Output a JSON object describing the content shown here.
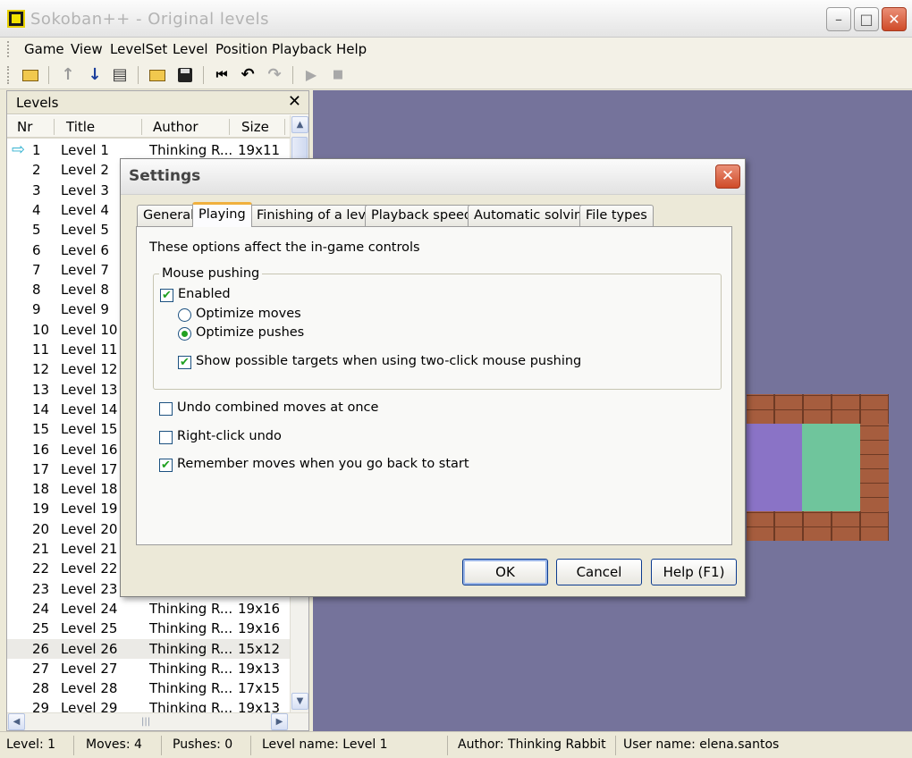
{
  "window": {
    "title": "Sokoban++ - Original levels",
    "minimize_glyph": "–",
    "maximize_glyph": "□",
    "close_glyph": "✕"
  },
  "menu": {
    "items": [
      "Game",
      "View",
      "LevelSet",
      "Level",
      "Position",
      "Playback",
      "Help"
    ]
  },
  "toolbar": {
    "icons": [
      "open-folder-icon",
      "arrow-up-icon",
      "arrow-down-icon",
      "level-list-icon",
      "open-file-icon",
      "save-icon",
      "rewind-icon",
      "undo-icon",
      "redo-icon",
      "play-icon",
      "stop-icon"
    ],
    "glyphs": {
      "up": "↑",
      "down": "↓",
      "list": "▤",
      "rewind": "⏮",
      "undo": "↶",
      "redo": "↷",
      "play": "▶",
      "stop": "■"
    }
  },
  "levels_panel": {
    "title": "Levels",
    "close_glyph": "✕",
    "columns": [
      "Nr",
      "Title",
      "Author",
      "Size"
    ],
    "current_marker": "⇨",
    "rows": [
      {
        "nr": "1",
        "title": "Level 1",
        "author": "Thinking R...",
        "size": "19x11"
      },
      {
        "nr": "2",
        "title": "Level 2",
        "author": "",
        "size": ""
      },
      {
        "nr": "3",
        "title": "Level 3",
        "author": "",
        "size": ""
      },
      {
        "nr": "4",
        "title": "Level 4",
        "author": "",
        "size": ""
      },
      {
        "nr": "5",
        "title": "Level 5",
        "author": "",
        "size": ""
      },
      {
        "nr": "6",
        "title": "Level 6",
        "author": "",
        "size": ""
      },
      {
        "nr": "7",
        "title": "Level 7",
        "author": "",
        "size": ""
      },
      {
        "nr": "8",
        "title": "Level 8",
        "author": "",
        "size": ""
      },
      {
        "nr": "9",
        "title": "Level 9",
        "author": "",
        "size": ""
      },
      {
        "nr": "10",
        "title": "Level 10",
        "author": "",
        "size": ""
      },
      {
        "nr": "11",
        "title": "Level 11",
        "author": "",
        "size": ""
      },
      {
        "nr": "12",
        "title": "Level 12",
        "author": "",
        "size": ""
      },
      {
        "nr": "13",
        "title": "Level 13",
        "author": "",
        "size": ""
      },
      {
        "nr": "14",
        "title": "Level 14",
        "author": "",
        "size": ""
      },
      {
        "nr": "15",
        "title": "Level 15",
        "author": "",
        "size": ""
      },
      {
        "nr": "16",
        "title": "Level 16",
        "author": "",
        "size": ""
      },
      {
        "nr": "17",
        "title": "Level 17",
        "author": "",
        "size": ""
      },
      {
        "nr": "18",
        "title": "Level 18",
        "author": "",
        "size": ""
      },
      {
        "nr": "19",
        "title": "Level 19",
        "author": "",
        "size": ""
      },
      {
        "nr": "20",
        "title": "Level 20",
        "author": "",
        "size": ""
      },
      {
        "nr": "21",
        "title": "Level 21",
        "author": "",
        "size": ""
      },
      {
        "nr": "22",
        "title": "Level 22",
        "author": "",
        "size": ""
      },
      {
        "nr": "23",
        "title": "Level 23",
        "author": "",
        "size": ""
      },
      {
        "nr": "24",
        "title": "Level 24",
        "author": "Thinking R...",
        "size": "19x16"
      },
      {
        "nr": "25",
        "title": "Level 25",
        "author": "Thinking R...",
        "size": "19x16"
      },
      {
        "nr": "26",
        "title": "Level 26",
        "author": "Thinking R...",
        "size": "15x12"
      },
      {
        "nr": "27",
        "title": "Level 27",
        "author": "Thinking R...",
        "size": "19x13"
      },
      {
        "nr": "28",
        "title": "Level 28",
        "author": "Thinking R...",
        "size": "17x15"
      },
      {
        "nr": "29",
        "title": "Level 29",
        "author": "Thinking R...",
        "size": "19x13"
      }
    ],
    "selected_row": "26",
    "scroll_up_glyph": "▲",
    "scroll_down_glyph": "▼",
    "scroll_left_glyph": "◀",
    "scroll_right_glyph": "▶",
    "hscroll_grip": "|||"
  },
  "settings_dialog": {
    "title": "Settings",
    "close_glyph": "✕",
    "tabs": [
      "General",
      "Playing",
      "Finishing of a level",
      "Playback speed",
      "Automatic solving",
      "File types"
    ],
    "active_tab": "Playing",
    "intro": "These options affect the in-game controls",
    "mouse_pushing": {
      "legend": "Mouse pushing",
      "enabled_label": "Enabled",
      "enabled": true,
      "optimize_moves_label": "Optimize moves",
      "optimize_moves": false,
      "optimize_pushes_label": "Optimize pushes",
      "optimize_pushes": true,
      "show_targets_label": "Show possible targets when using two-click mouse pushing",
      "show_targets": true
    },
    "undo_combined_label": "Undo combined moves at once",
    "undo_combined": false,
    "right_click_undo_label": "Right-click undo",
    "right_click_undo": false,
    "remember_moves_label": "Remember moves when you go back to start",
    "remember_moves": true,
    "check_glyph": "✔",
    "buttons": {
      "ok": "OK",
      "cancel": "Cancel",
      "help": "Help (F1)"
    }
  },
  "statusbar": {
    "level": "Level: 1",
    "moves": "Moves: 4",
    "pushes": "Pushes: 0",
    "level_name": "Level name: Level 1",
    "author": "Author: Thinking Rabbit",
    "user": "User name: elena.santos"
  },
  "colors": {
    "game_background": "#75739b",
    "wall_brick": "#a65d3e",
    "floor_purple": "#8a73c6",
    "goal_green": "#6fc59c",
    "active_tab_accent": "#f0b03e",
    "check_green": "#21a121"
  }
}
